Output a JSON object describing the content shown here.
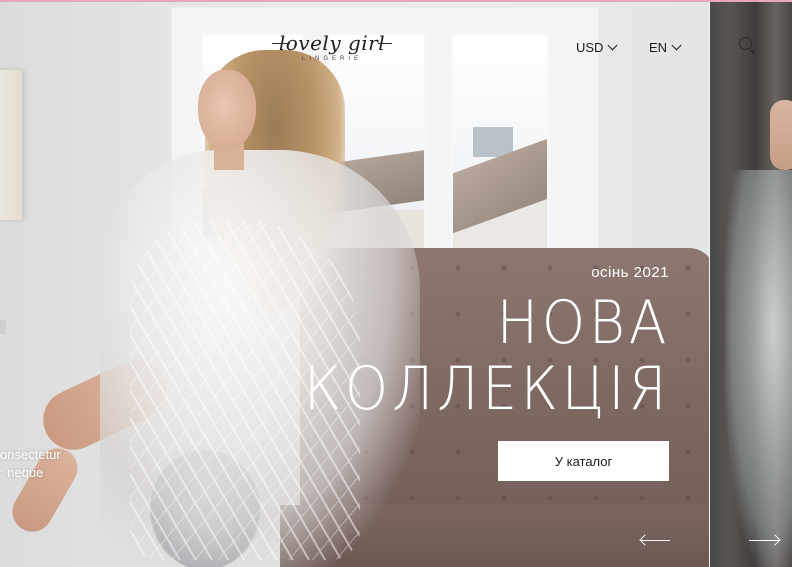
{
  "brand": {
    "logo_script": "lovely girl",
    "logo_sub": "LINGERIE"
  },
  "header": {
    "currency": "USD",
    "language": "EN",
    "search_icon": "search-icon"
  },
  "hero": {
    "season": "осінь 2021",
    "headline_line1": "НОВА",
    "headline_line2": "КОЛЛЕКЦІЯ",
    "button_label": "У каталог"
  },
  "side_slide": {
    "line1": "onsectetur",
    "line2": ": neque"
  },
  "slider": {
    "prev_icon": "arrow-left-icon",
    "next_icon": "arrow-right-icon"
  },
  "colors": {
    "accent_line": "#e8a7b6",
    "button_bg": "#ffffff",
    "hero_text": "#ffffff"
  }
}
